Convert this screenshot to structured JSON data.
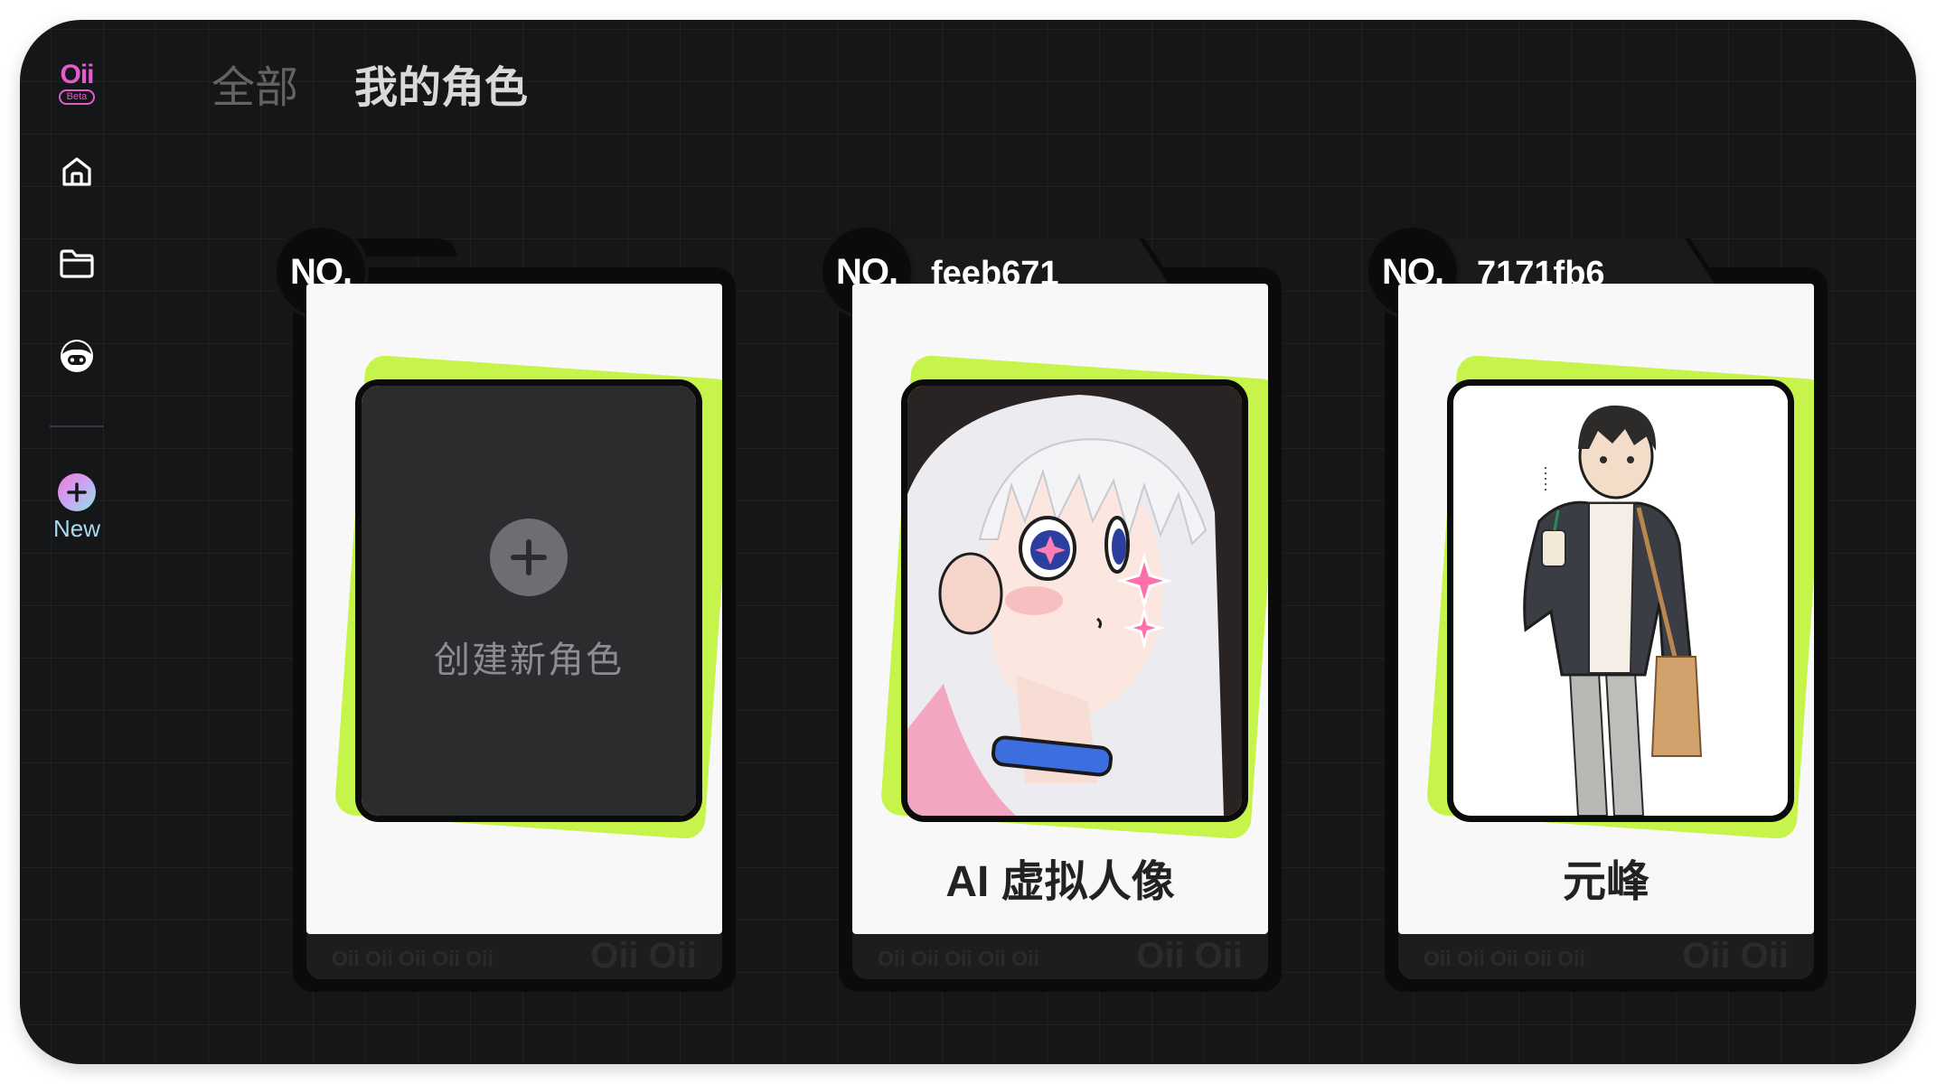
{
  "app": {
    "logo_text": "Oii",
    "logo_badge": "Beta",
    "brand_color": "#e45bd0",
    "accent_color": "#c6f44a"
  },
  "sidebar": {
    "items": [
      {
        "icon": "home-icon"
      },
      {
        "icon": "folder-icon"
      },
      {
        "icon": "character-face-icon"
      }
    ],
    "new_label": "New"
  },
  "tabs": [
    {
      "label": "全部",
      "active": false
    },
    {
      "label": "我的角色",
      "active": true
    }
  ],
  "cards": [
    {
      "no_label": "NO.",
      "id": "",
      "create_label": "创建新角色",
      "name": "",
      "footer_small": "Oii Oii Oii Oii Oii",
      "footer_big": "Oii Oii"
    },
    {
      "no_label": "NO.",
      "id": "feeb671",
      "name": "AI 虚拟人像",
      "footer_small": "Oii Oii Oii Oii Oii",
      "footer_big": "Oii Oii"
    },
    {
      "no_label": "NO.",
      "id": "7171fb6",
      "name": "元峰",
      "footer_small": "Oii Oii Oii Oii Oii",
      "footer_big": "Oii Oii"
    }
  ]
}
